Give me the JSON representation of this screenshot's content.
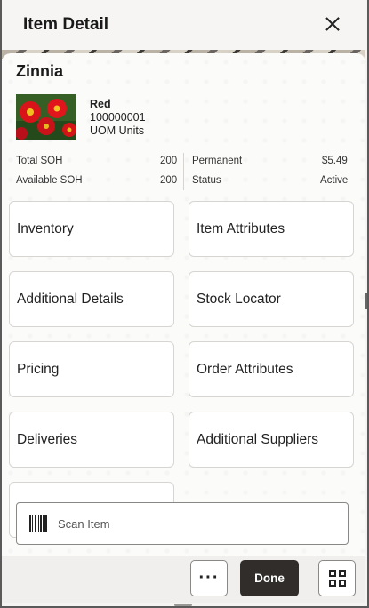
{
  "header": {
    "title": "Item Detail",
    "close_icon": "close-icon"
  },
  "item": {
    "name": "Zinnia",
    "color": "Red",
    "number": "100000001",
    "uom": "UOM Units",
    "image": "zinnia-flowers-photo"
  },
  "stats": {
    "total_soh_label": "Total SOH",
    "total_soh_value": "200",
    "available_soh_label": "Available SOH",
    "available_soh_value": "200",
    "price_label": "Permanent",
    "price_value": "$5.49",
    "status_label": "Status",
    "status_value": "Active"
  },
  "tiles": [
    "Inventory",
    "Item Attributes",
    "Additional Details",
    "Stock Locator",
    "Pricing",
    "Order Attributes",
    "Deliveries",
    "Additional Suppliers"
  ],
  "scan": {
    "label": "Scan Item",
    "icon": "barcode-icon"
  },
  "footer": {
    "more_label": "···",
    "done_label": "Done",
    "grid_icon": "grid-icon"
  },
  "colors": {
    "done_bg": "#312d2a",
    "page_bg": "#fbfbfa"
  }
}
